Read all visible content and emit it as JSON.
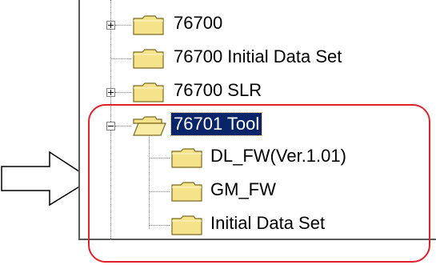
{
  "tree": {
    "items": [
      {
        "label": "76700",
        "expander": "plus",
        "icon": "folder-closed-icon"
      },
      {
        "label": "76700 Initial Data Set",
        "expander": "none",
        "icon": "folder-closed-icon"
      },
      {
        "label": "76700 SLR",
        "expander": "plus",
        "icon": "folder-closed-icon"
      },
      {
        "label": "76701 Tool",
        "expander": "minus",
        "icon": "folder-open-icon",
        "selected": true,
        "children": [
          {
            "label": "DL_FW(Ver.1.01)",
            "icon": "folder-closed-icon"
          },
          {
            "label": "GM_FW",
            "icon": "folder-closed-icon"
          },
          {
            "label": "Initial Data Set",
            "icon": "folder-closed-icon"
          }
        ]
      }
    ]
  },
  "annotation": {
    "arrow_icon": "right-arrow-outline-icon",
    "highlight_color": "#e0202a"
  },
  "colors": {
    "folder_fill": "#f4e38a",
    "folder_stroke": "#7a6a20",
    "selection_bg": "#0a246a"
  }
}
